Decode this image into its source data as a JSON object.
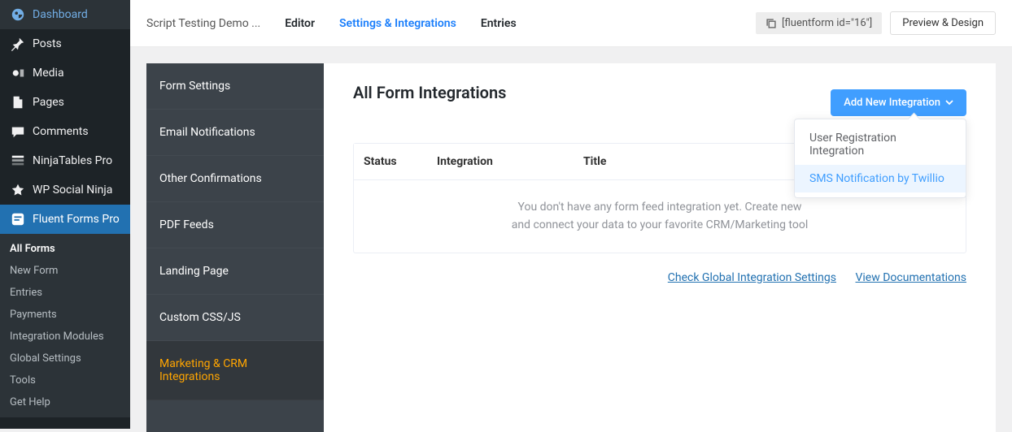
{
  "wp_sidebar": {
    "items": [
      {
        "label": "Dashboard",
        "icon": "dashboard"
      },
      {
        "label": "Posts",
        "icon": "pin"
      },
      {
        "label": "Media",
        "icon": "media"
      },
      {
        "label": "Pages",
        "icon": "pages"
      },
      {
        "label": "Comments",
        "icon": "comments"
      },
      {
        "label": "NinjaTables Pro",
        "icon": "tables"
      },
      {
        "label": "WP Social Ninja",
        "icon": "social"
      },
      {
        "label": "Fluent Forms Pro",
        "icon": "forms"
      }
    ],
    "submenu": [
      {
        "label": "All Forms"
      },
      {
        "label": "New Form"
      },
      {
        "label": "Entries"
      },
      {
        "label": "Payments"
      },
      {
        "label": "Integration Modules"
      },
      {
        "label": "Global Settings"
      },
      {
        "label": "Tools"
      },
      {
        "label": "Get Help"
      }
    ]
  },
  "topbar": {
    "title": "Script Testing Demo ...",
    "tabs": [
      {
        "label": "Editor"
      },
      {
        "label": "Settings & Integrations"
      },
      {
        "label": "Entries"
      }
    ],
    "shortcode": "[fluentform id=\"16\"]",
    "preview": "Preview & Design"
  },
  "settings_menu": [
    {
      "label": "Form Settings"
    },
    {
      "label": "Email Notifications"
    },
    {
      "label": "Other Confirmations"
    },
    {
      "label": "PDF Feeds"
    },
    {
      "label": "Landing Page"
    },
    {
      "label": "Custom CSS/JS"
    },
    {
      "label": "Marketing & CRM Integrations"
    }
  ],
  "main": {
    "heading": "All Form Integrations",
    "add_button": "Add New Integration",
    "dropdown": [
      {
        "label": "User Registration Integration"
      },
      {
        "label": "SMS Notification by Twillio"
      }
    ],
    "table": {
      "headers": {
        "status": "Status",
        "integration": "Integration",
        "title": "Title"
      },
      "empty_line1": "You don't have any form feed integration yet. Create new",
      "empty_line2": "and connect your data to your favorite CRM/Marketing tool"
    },
    "links": {
      "global": "Check Global Integration Settings",
      "docs": "View Documentations"
    }
  }
}
